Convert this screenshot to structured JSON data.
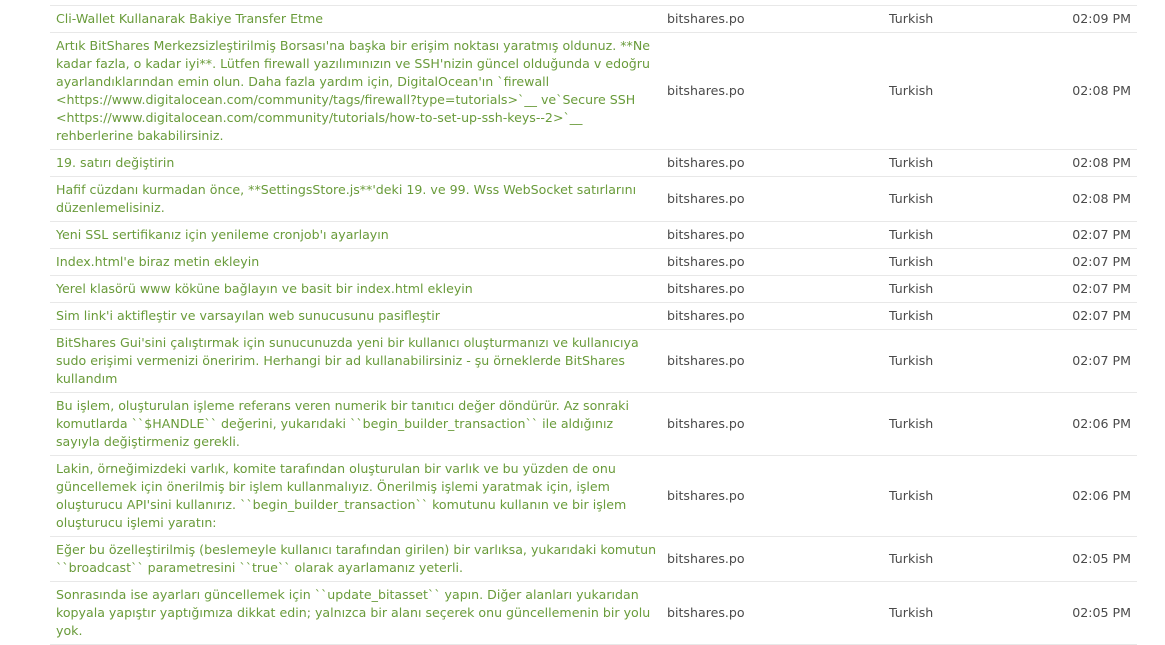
{
  "rows": [
    {
      "text": "Cli-Wallet Kullanarak Bakiye Transfer Etme",
      "user": "bitshares.po",
      "language": "Turkish",
      "time": "02:09 PM"
    },
    {
      "text": "Artık BitShares Merkezsizleştirilmiş Borsası'na başka bir erişim noktası yaratmış oldunuz. **Ne kadar fazla, o kadar iyi**. Lütfen firewall yazılımınızın ve SSH'nizin güncel olduğunda v edoğru ayarlandıklarından emin olun. Daha fazla yardım için, DigitalOcean'ın `firewall <https://www.digitalocean.com/community/tags/firewall?type=tutorials>`__ ve`Secure SSH <https://www.digitalocean.com/community/tutorials/how-to-set-up-ssh-keys--2>`__ rehberlerine bakabilirsiniz.",
      "user": "bitshares.po",
      "language": "Turkish",
      "time": "02:08 PM"
    },
    {
      "text": "19. satırı değiştirin",
      "user": "bitshares.po",
      "language": "Turkish",
      "time": "02:08 PM"
    },
    {
      "text": "Hafif cüzdanı kurmadan önce, **SettingsStore.js**'deki 19. ve 99. Wss WebSocket satırlarını düzenlemelisiniz.",
      "user": "bitshares.po",
      "language": "Turkish",
      "time": "02:08 PM"
    },
    {
      "text": "Yeni SSL sertifikanız için yenileme cronjob'ı ayarlayın",
      "user": "bitshares.po",
      "language": "Turkish",
      "time": "02:07 PM"
    },
    {
      "text": "Index.html'e biraz metin ekleyin",
      "user": "bitshares.po",
      "language": "Turkish",
      "time": "02:07 PM"
    },
    {
      "text": "Yerel klasörü www köküne bağlayın ve basit bir index.html ekleyin",
      "user": "bitshares.po",
      "language": "Turkish",
      "time": "02:07 PM"
    },
    {
      "text": "Sim link'i aktifleştir ve varsayılan web sunucusunu pasifleştir",
      "user": "bitshares.po",
      "language": "Turkish",
      "time": "02:07 PM"
    },
    {
      "text": "BitShares Gui'sini çalıştırmak için sunucunuzda yeni bir kullanıcı oluşturmanızı ve kullanıcıya sudo erişimi vermenizi öneririm. Herhangi bir ad kullanabilirsiniz - şu örneklerde BitShares kullandım",
      "user": "bitshares.po",
      "language": "Turkish",
      "time": "02:07 PM"
    },
    {
      "text": "Bu işlem, oluşturulan işleme referans veren numerik bir tanıtıcı değer döndürür. Az sonraki komutlarda ``$HANDLE`` değerini, yukarıdaki ``begin_builder_transaction`` ile aldığınız sayıyla değiştirmeniz gerekli.",
      "user": "bitshares.po",
      "language": "Turkish",
      "time": "02:06 PM"
    },
    {
      "text": "Lakin, örneğimizdeki varlık, komite tarafından oluşturulan bir varlık ve bu yüzden de onu güncellemek için önerilmiş bir işlem kullanmalıyız. Önerilmiş işlemi yaratmak için, işlem oluşturucu API'sini kullanırız. ``begin_builder_transaction`` komutunu kullanın ve bir işlem oluşturucu işlemi yaratın:",
      "user": "bitshares.po",
      "language": "Turkish",
      "time": "02:06 PM"
    },
    {
      "text": "Eğer bu özelleştirilmiş (beslemeyle kullanıcı tarafından girilen) bir varlıksa, yukarıdaki komutun ``broadcast`` parametresini ``true`` olarak ayarlamanız yeterli.",
      "user": "bitshares.po",
      "language": "Turkish",
      "time": "02:05 PM"
    },
    {
      "text": "Sonrasında ise ayarları güncellemek için ``update_bitasset`` yapın. Diğer alanları yukarıdan kopyala yapıştır yaptığımıza dikkat edin; yalnızca bir alanı seçerek onu güncellemenin bir yolu yok.",
      "user": "bitshares.po",
      "language": "Turkish",
      "time": "02:05 PM"
    }
  ]
}
